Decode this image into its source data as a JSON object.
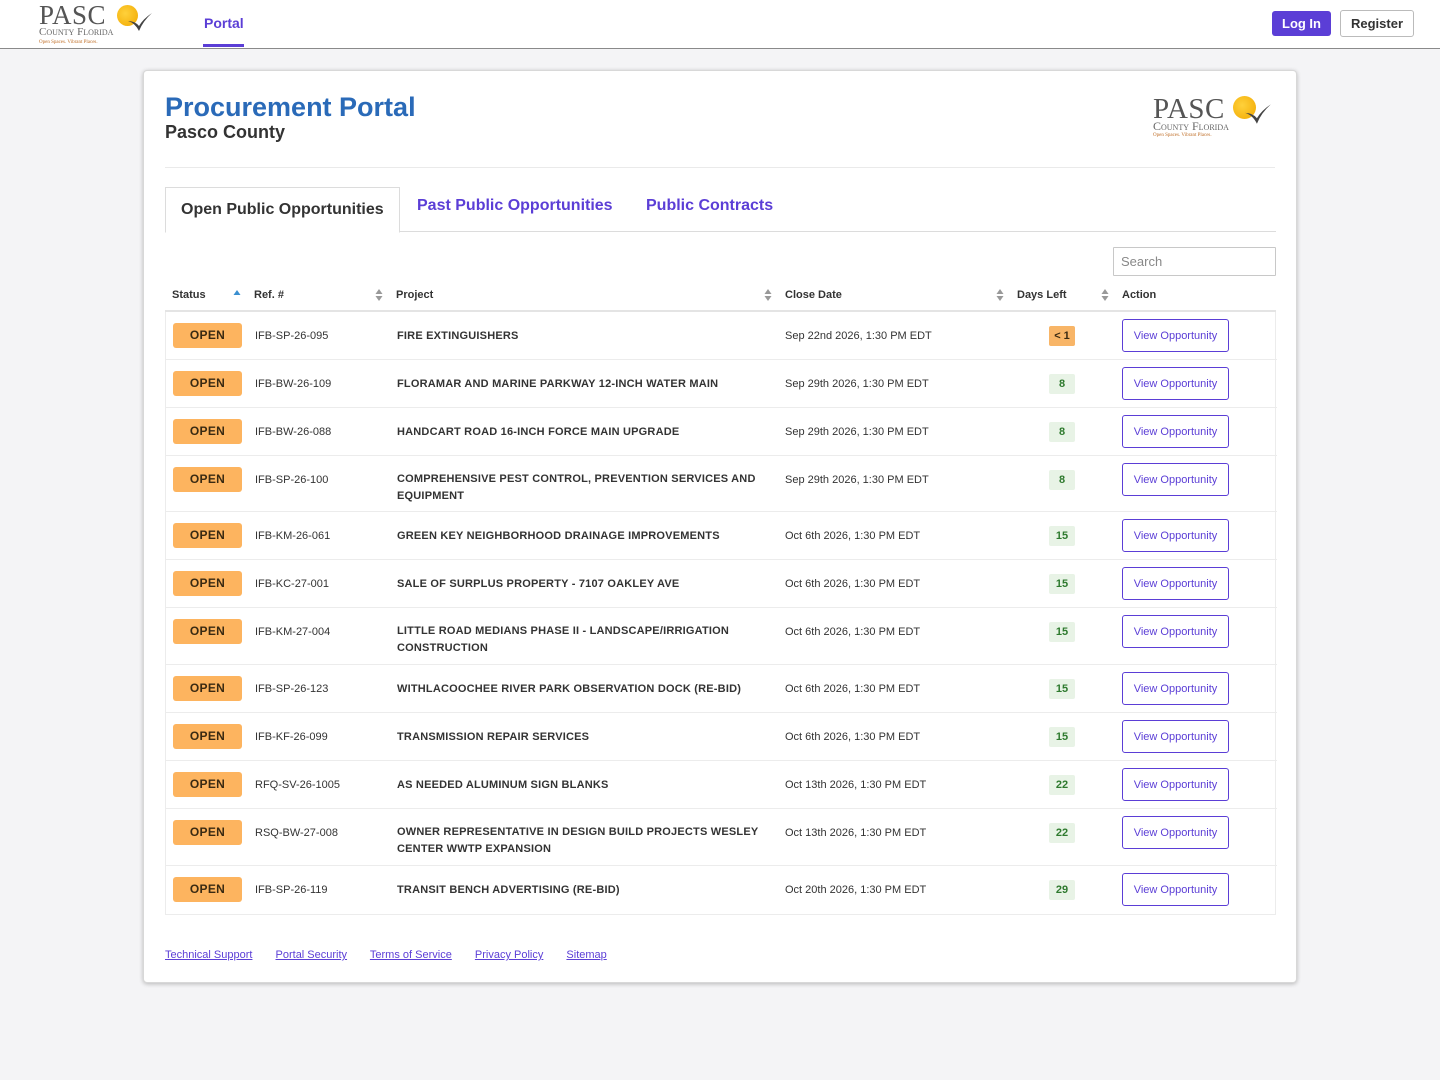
{
  "brand": {
    "logo_word": "PASC",
    "logo_county": "County Florida",
    "logo_tagline": "Open Spaces. Vibrant Places."
  },
  "nav": {
    "tab_portal": "Portal",
    "login_label": "Log In",
    "register_label": "Register"
  },
  "header": {
    "title": "Procurement Portal",
    "subtitle": "Pasco County"
  },
  "tabs": {
    "open": "Open Public Opportunities",
    "past": "Past Public Opportunities",
    "contracts": "Public Contracts"
  },
  "search": {
    "placeholder": "Search"
  },
  "table": {
    "columns": {
      "status": "Status",
      "ref": "Ref. #",
      "project": "Project",
      "close_date": "Close Date",
      "days_left": "Days Left",
      "action": "Action"
    },
    "rows": [
      {
        "status": "OPEN",
        "ref": "IFB-SP-26-095",
        "project": "FIRE EXTINGUISHERS",
        "close_date": "Sep 22nd 2026, 1:30 PM EDT",
        "days_left": "< 1",
        "action": "View Opportunity"
      },
      {
        "status": "OPEN",
        "ref": "IFB-BW-26-109",
        "project": "FLORAMAR AND MARINE PARKWAY 12-INCH WATER MAIN",
        "close_date": "Sep 29th 2026, 1:30 PM EDT",
        "days_left": "8",
        "action": "View Opportunity"
      },
      {
        "status": "OPEN",
        "ref": "IFB-BW-26-088",
        "project": "HANDCART ROAD 16-INCH FORCE MAIN UPGRADE",
        "close_date": "Sep 29th 2026, 1:30 PM EDT",
        "days_left": "8",
        "action": "View Opportunity"
      },
      {
        "status": "OPEN",
        "ref": "IFB-SP-26-100",
        "project": "COMPREHENSIVE PEST CONTROL, PREVENTION SERVICES AND EQUIPMENT",
        "close_date": "Sep 29th 2026, 1:30 PM EDT",
        "days_left": "8",
        "action": "View Opportunity"
      },
      {
        "status": "OPEN",
        "ref": "IFB-KM-26-061",
        "project": "GREEN KEY NEIGHBORHOOD DRAINAGE IMPROVEMENTS",
        "close_date": "Oct 6th 2026, 1:30 PM EDT",
        "days_left": "15",
        "action": "View Opportunity"
      },
      {
        "status": "OPEN",
        "ref": "IFB-KC-27-001",
        "project": "SALE OF SURPLUS PROPERTY - 7107 OAKLEY AVE",
        "close_date": "Oct 6th 2026, 1:30 PM EDT",
        "days_left": "15",
        "action": "View Opportunity"
      },
      {
        "status": "OPEN",
        "ref": "IFB-KM-27-004",
        "project": "LITTLE ROAD MEDIANS PHASE II - LANDSCAPE/IRRIGATION CONSTRUCTION",
        "close_date": "Oct 6th 2026, 1:30 PM EDT",
        "days_left": "15",
        "action": "View Opportunity"
      },
      {
        "status": "OPEN",
        "ref": "IFB-SP-26-123",
        "project": "WITHLACOOCHEE RIVER PARK OBSERVATION DOCK (RE-BID)",
        "close_date": "Oct 6th 2026, 1:30 PM EDT",
        "days_left": "15",
        "action": "View Opportunity"
      },
      {
        "status": "OPEN",
        "ref": "IFB-KF-26-099",
        "project": "TRANSMISSION REPAIR SERVICES",
        "close_date": "Oct 6th 2026, 1:30 PM EDT",
        "days_left": "15",
        "action": "View Opportunity"
      },
      {
        "status": "OPEN",
        "ref": "RFQ-SV-26-1005",
        "project": "AS NEEDED ALUMINUM SIGN BLANKS",
        "close_date": "Oct 13th 2026, 1:30 PM EDT",
        "days_left": "22",
        "action": "View Opportunity"
      },
      {
        "status": "OPEN",
        "ref": "RSQ-BW-27-008",
        "project": "OWNER REPRESENTATIVE IN DESIGN BUILD PROJECTS WESLEY CENTER WWTP EXPANSION",
        "close_date": "Oct 13th 2026, 1:30 PM EDT",
        "days_left": "22",
        "action": "View Opportunity"
      },
      {
        "status": "OPEN",
        "ref": "IFB-SP-26-119",
        "project": "TRANSIT BENCH ADVERTISING (RE-BID)",
        "close_date": "Oct 20th 2026, 1:30 PM EDT",
        "days_left": "29",
        "action": "View Opportunity"
      }
    ]
  },
  "footer": {
    "links": [
      "Technical Support",
      "Portal Security",
      "Terms of Service",
      "Privacy Policy",
      "Sitemap"
    ]
  },
  "colors": {
    "accent": "#5b3ed6",
    "title_blue": "#2a6ab8",
    "open_badge": "#fdb45f",
    "days_green_bg": "#e8f3e6",
    "days_urgent_bg": "#f8b567"
  }
}
